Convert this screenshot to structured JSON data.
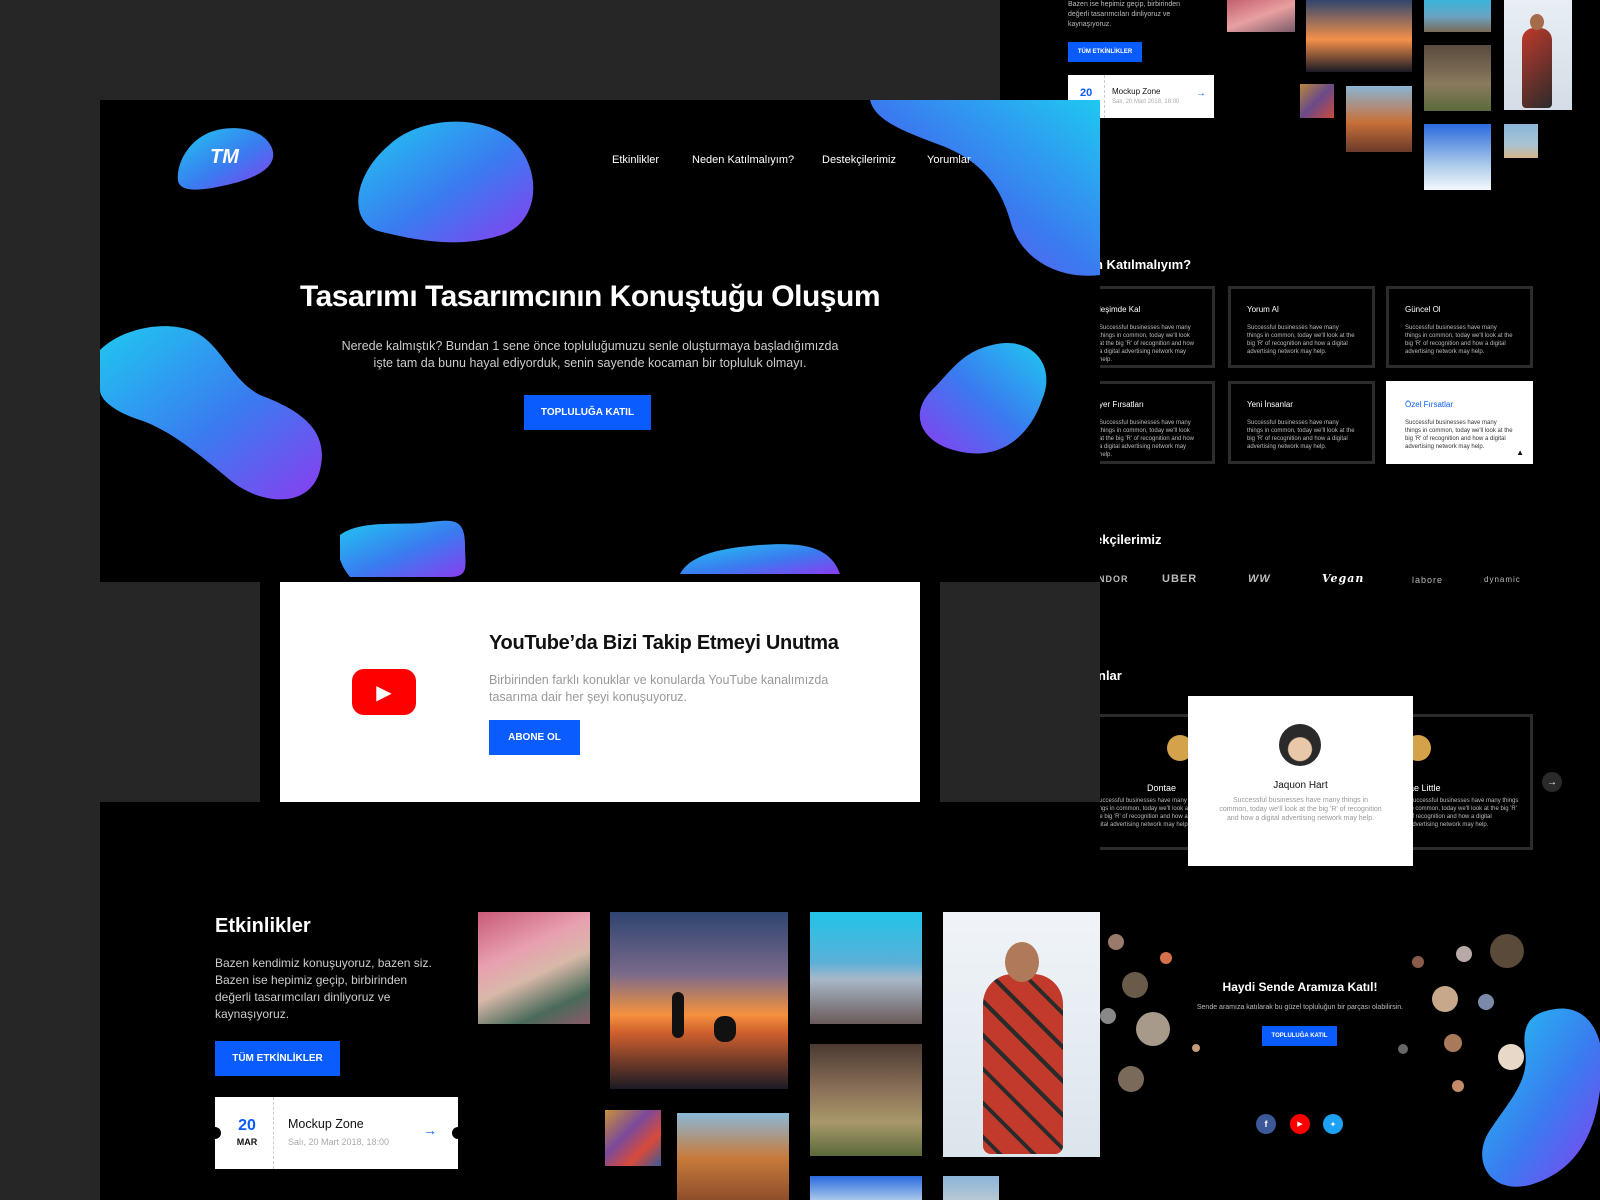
{
  "nav": {
    "logo_text": "TM",
    "items": [
      "Etkinlikler",
      "Neden Katılmalıyım?",
      "Destekçilerimiz",
      "Yorumlar"
    ]
  },
  "hero": {
    "title": "Tasarımı Tasarımcının Konuştuğu Oluşum",
    "subtitle_line1": "Nerede kalmıştık? Bundan 1 sene önce topluluğumuzu senle oluşturmaya başladığımızda",
    "subtitle_line2": "işte tam da bunu hayal ediyorduk, senin sayende kocaman bir topluluk olmayı.",
    "cta": "TOPLULUĞA KATIL"
  },
  "youtube": {
    "title": "YouTube’da Bizi Takip Etmeyi Unutma",
    "text_line1": "Birbirinden farklı konuklar ve konularda YouTube kanalımızda",
    "text_line2": "tasarıma dair her şeyi konuşuyoruz.",
    "cta": "ABONE OL"
  },
  "events": {
    "title": "Etkinlikler",
    "desc_lines": [
      "Bazen kendimiz konuşuyoruz, bazen siz.",
      "Bazen ise hepimiz geçip, birbirinden",
      "değerli tasarımcıları dinliyoruz ve",
      "kaynaşıyoruz."
    ],
    "cta": "TÜM ETKİNLİKLER",
    "ticket": {
      "day": "20",
      "month": "MAR",
      "name": "Mockup Zone",
      "date": "Salı, 20 Mart 2018, 18:00"
    }
  },
  "right_top": {
    "desc_lines": [
      "Bazen ise hepimiz geçip, birbirinden",
      "değerli tasarımcıları dinliyoruz ve",
      "kaynaşıyoruz."
    ],
    "cta": "TÜM ETKİNLİKLER",
    "ticket": {
      "day": "20",
      "name": "Mockup Zone",
      "date": "Salı, 20 Mart 2018, 18:00"
    }
  },
  "why": {
    "title": "n Katılmalıyım?",
    "body": "Successful businesses have many things in common, today we'll look at the big 'R' of recognition and how a digital advertising network may help.",
    "body_cut": "Successful businesses have many things in common, today we'll look at the big 'R' of recognition and how a digital advertising network may help.",
    "cards": [
      {
        "title": "leşimde Kal"
      },
      {
        "title": "Yorum Al"
      },
      {
        "title": "Güncel Ol"
      },
      {
        "title": "yer Fırsatları"
      },
      {
        "title": "Yeni İnsanlar"
      },
      {
        "title": "Özel Fırsatlar"
      }
    ]
  },
  "sponsors": {
    "title": "ekçilerimiz",
    "logos": [
      "NDOR",
      "UBER",
      "WW",
      "Vegan",
      "labore",
      "dynamic"
    ]
  },
  "reviews": {
    "title": "nlar",
    "center": {
      "name": "Jaquon Hart",
      "text": "Successful businesses have many things in common, today we'll look at the big 'R' of recognition and how a digital advertising network may help."
    },
    "left_name": "Dontae",
    "right_name": "ae Little",
    "side_text": "Successful businesses have many things in common, today we'll look at the big 'R' of recognition and how a digital advertising network may help."
  },
  "join": {
    "title": "Haydi Sende Aramıza Katıl!",
    "text": "Sende aramıza katılarak bu güzel topluluğun bir parçası olabilirsin.",
    "cta": "TOPLULUĞA KATIL"
  },
  "colors": {
    "accent": "#0a5cff",
    "youtube_red": "#ff0000",
    "facebook": "#3b5998",
    "twitter": "#1da1f2"
  }
}
